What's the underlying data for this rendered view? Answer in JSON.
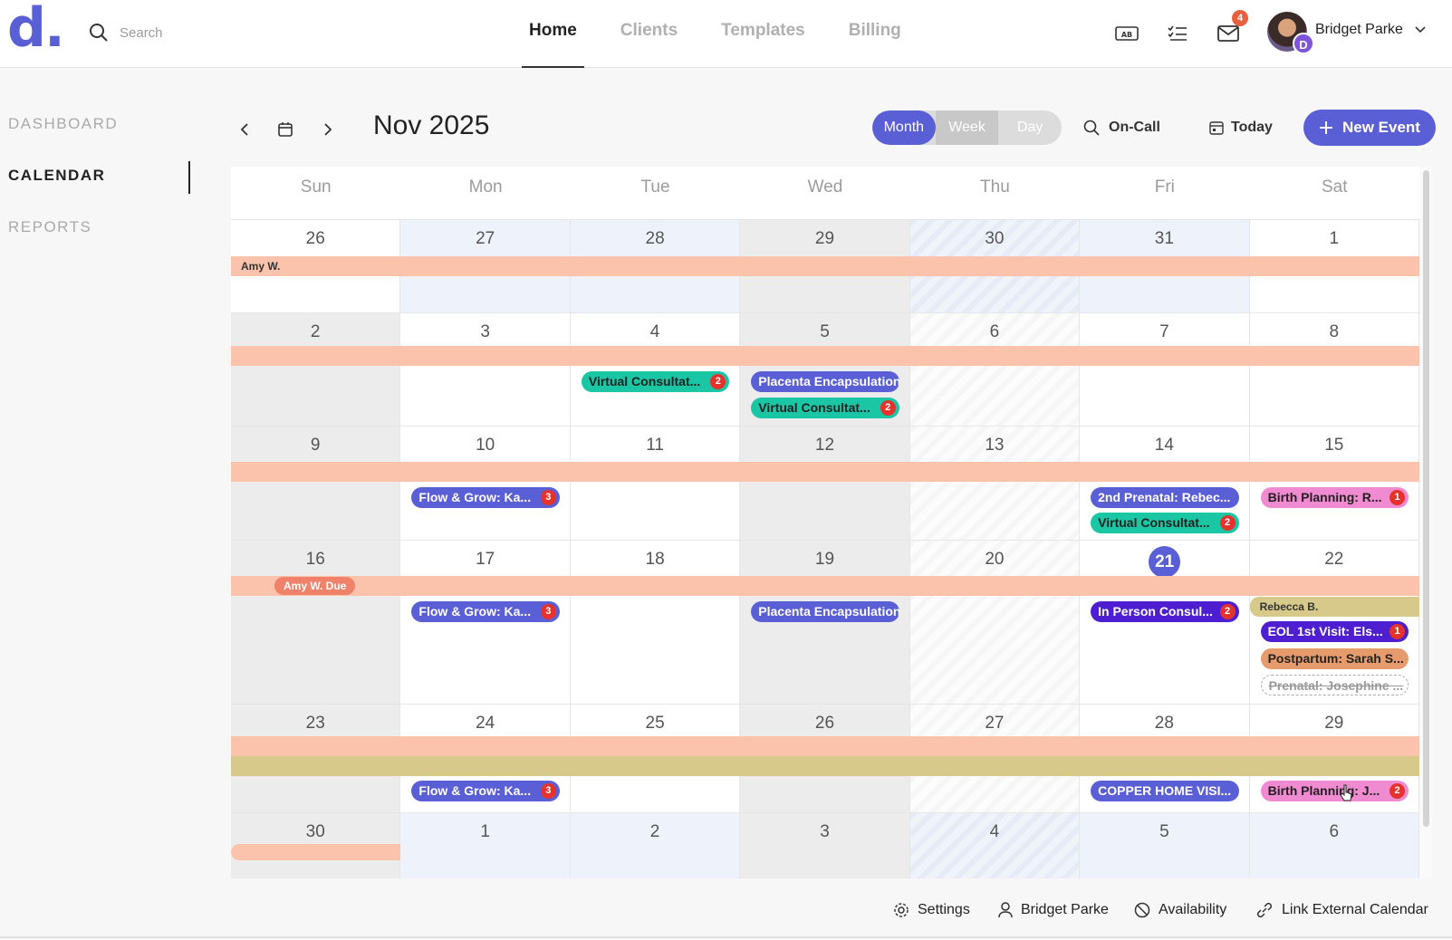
{
  "brand": {
    "logo": "d.",
    "accent": "#5a5fd6"
  },
  "search": {
    "placeholder": "Search"
  },
  "nav": {
    "tabs": [
      "Home",
      "Clients",
      "Templates",
      "Billing"
    ],
    "active": "Home"
  },
  "header": {
    "notification_count": "4",
    "user_name": "Bridget Parke",
    "avatar_badge": "D"
  },
  "sidebar": {
    "items": [
      "DASHBOARD",
      "CALENDAR",
      "REPORTS"
    ],
    "active": "CALENDAR"
  },
  "calendar": {
    "title": "Nov 2025",
    "views": [
      "Month",
      "Week",
      "Day"
    ],
    "active_view": "Month",
    "on_call_label": "On-Call",
    "today_label": "Today",
    "new_event_label": "New Event",
    "day_names": [
      "Sun",
      "Mon",
      "Tue",
      "Wed",
      "Thu",
      "Fri",
      "Sat"
    ],
    "weeks": [
      {
        "days": [
          "26",
          "27",
          "28",
          "29",
          "30",
          "31",
          "1"
        ]
      },
      {
        "days": [
          "2",
          "3",
          "4",
          "5",
          "6",
          "7",
          "8"
        ]
      },
      {
        "days": [
          "9",
          "10",
          "11",
          "12",
          "13",
          "14",
          "15"
        ]
      },
      {
        "days": [
          "16",
          "17",
          "18",
          "19",
          "20",
          "21",
          "22"
        ]
      },
      {
        "days": [
          "23",
          "24",
          "25",
          "26",
          "27",
          "28",
          "29"
        ]
      },
      {
        "days": [
          "30",
          "1",
          "2",
          "3",
          "4",
          "5",
          "6"
        ]
      }
    ],
    "today_date": "21",
    "bands": {
      "w0_label": "Amy W.",
      "w3_due": "Amy W. Due",
      "w3_sat": "Rebecca B."
    },
    "events": {
      "w1_tue": {
        "label": "Virtual Consultat...",
        "count": "2"
      },
      "w1_wed_a": {
        "label": "Placenta Encapsulation"
      },
      "w1_wed_b": {
        "label": "Virtual Consultat...",
        "count": "2"
      },
      "w2_mon": {
        "label": "Flow & Grow: Ka...",
        "count": "3"
      },
      "w2_fri_a": {
        "label": "2nd Prenatal: Rebec..."
      },
      "w2_fri_b": {
        "label": "Virtual Consultat...",
        "count": "2"
      },
      "w2_sat": {
        "label": "Birth Planning: R...",
        "count": "1"
      },
      "w3_mon": {
        "label": "Flow & Grow: Ka...",
        "count": "3"
      },
      "w3_wed": {
        "label": "Placenta Encapsulation"
      },
      "w3_fri": {
        "label": "In Person Consul...",
        "count": "2"
      },
      "w3_sat_a": {
        "label": "EOL 1st Visit: Els...",
        "count": "1"
      },
      "w3_sat_b": {
        "label": "Postpartum: Sarah S..."
      },
      "w3_sat_c": {
        "label": "Prenatal: Josephine ..."
      },
      "w4_mon": {
        "label": "Flow & Grow: Ka...",
        "count": "3"
      },
      "w4_fri": {
        "label": "COPPER HOME VISI..."
      },
      "w4_sat": {
        "label": "Birth Planning: J...",
        "count": "2"
      }
    }
  },
  "footer": {
    "settings": "Settings",
    "user": "Bridget Parke",
    "availability": "Availability",
    "link_calendar": "Link External Calendar"
  }
}
